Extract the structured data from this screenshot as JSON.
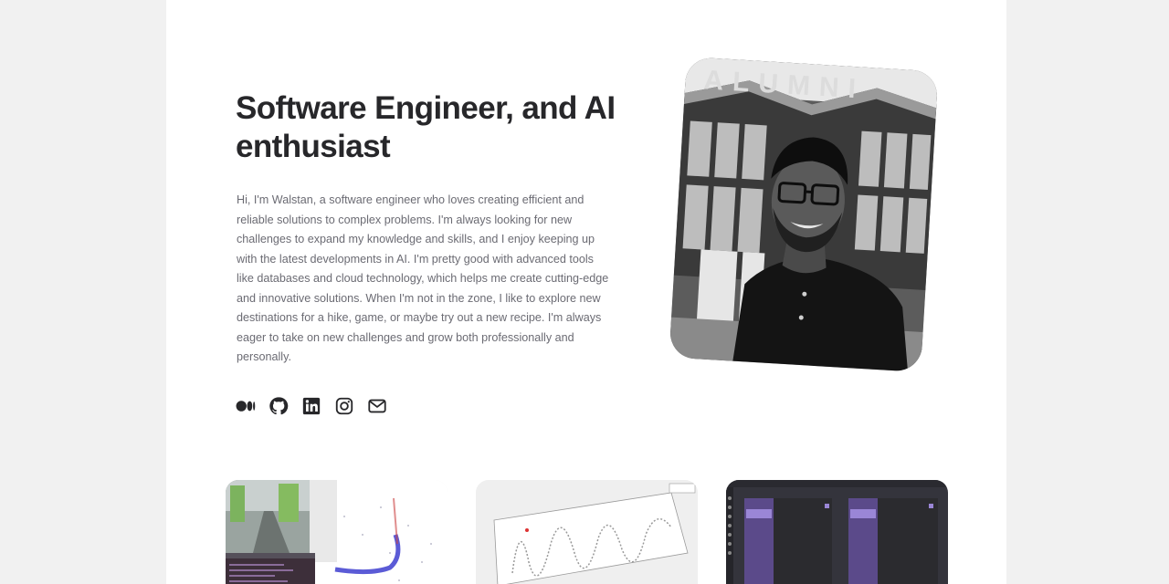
{
  "hero": {
    "headline": "Software Engineer, and AI enthusiast",
    "bio": "Hi, I'm Walstan, a software engineer who loves creating efficient and reliable solutions to complex problems. I'm always looking for new challenges to expand my knowledge and skills, and I enjoy keeping up with the latest developments in AI. I'm pretty good with advanced tools like databases and cloud technology, which helps me create cutting-edge and innovative solutions. When I'm not in the zone, I like to explore new destinations for a hike, game, or maybe try out a new recipe. I'm always eager to take on new challenges and grow both professionally and personally."
  },
  "socials": [
    {
      "icon": "medium-icon"
    },
    {
      "icon": "github-icon"
    },
    {
      "icon": "linkedin-icon"
    },
    {
      "icon": "instagram-icon"
    },
    {
      "icon": "mail-icon"
    }
  ],
  "portrait": {
    "sign_text": "ALUMNI"
  },
  "projects": [
    {
      "image": "driving-simulation-screenshot"
    },
    {
      "image": "trajectory-plot-screenshot"
    },
    {
      "image": "chat-app-screenshot"
    }
  ],
  "colors": {
    "background": "#f1f1f1",
    "surface": "#ffffff",
    "heading": "#27272a",
    "body_text": "#6b6b73",
    "icon": "#27272a",
    "chat_purple": "#5b4a8a"
  }
}
